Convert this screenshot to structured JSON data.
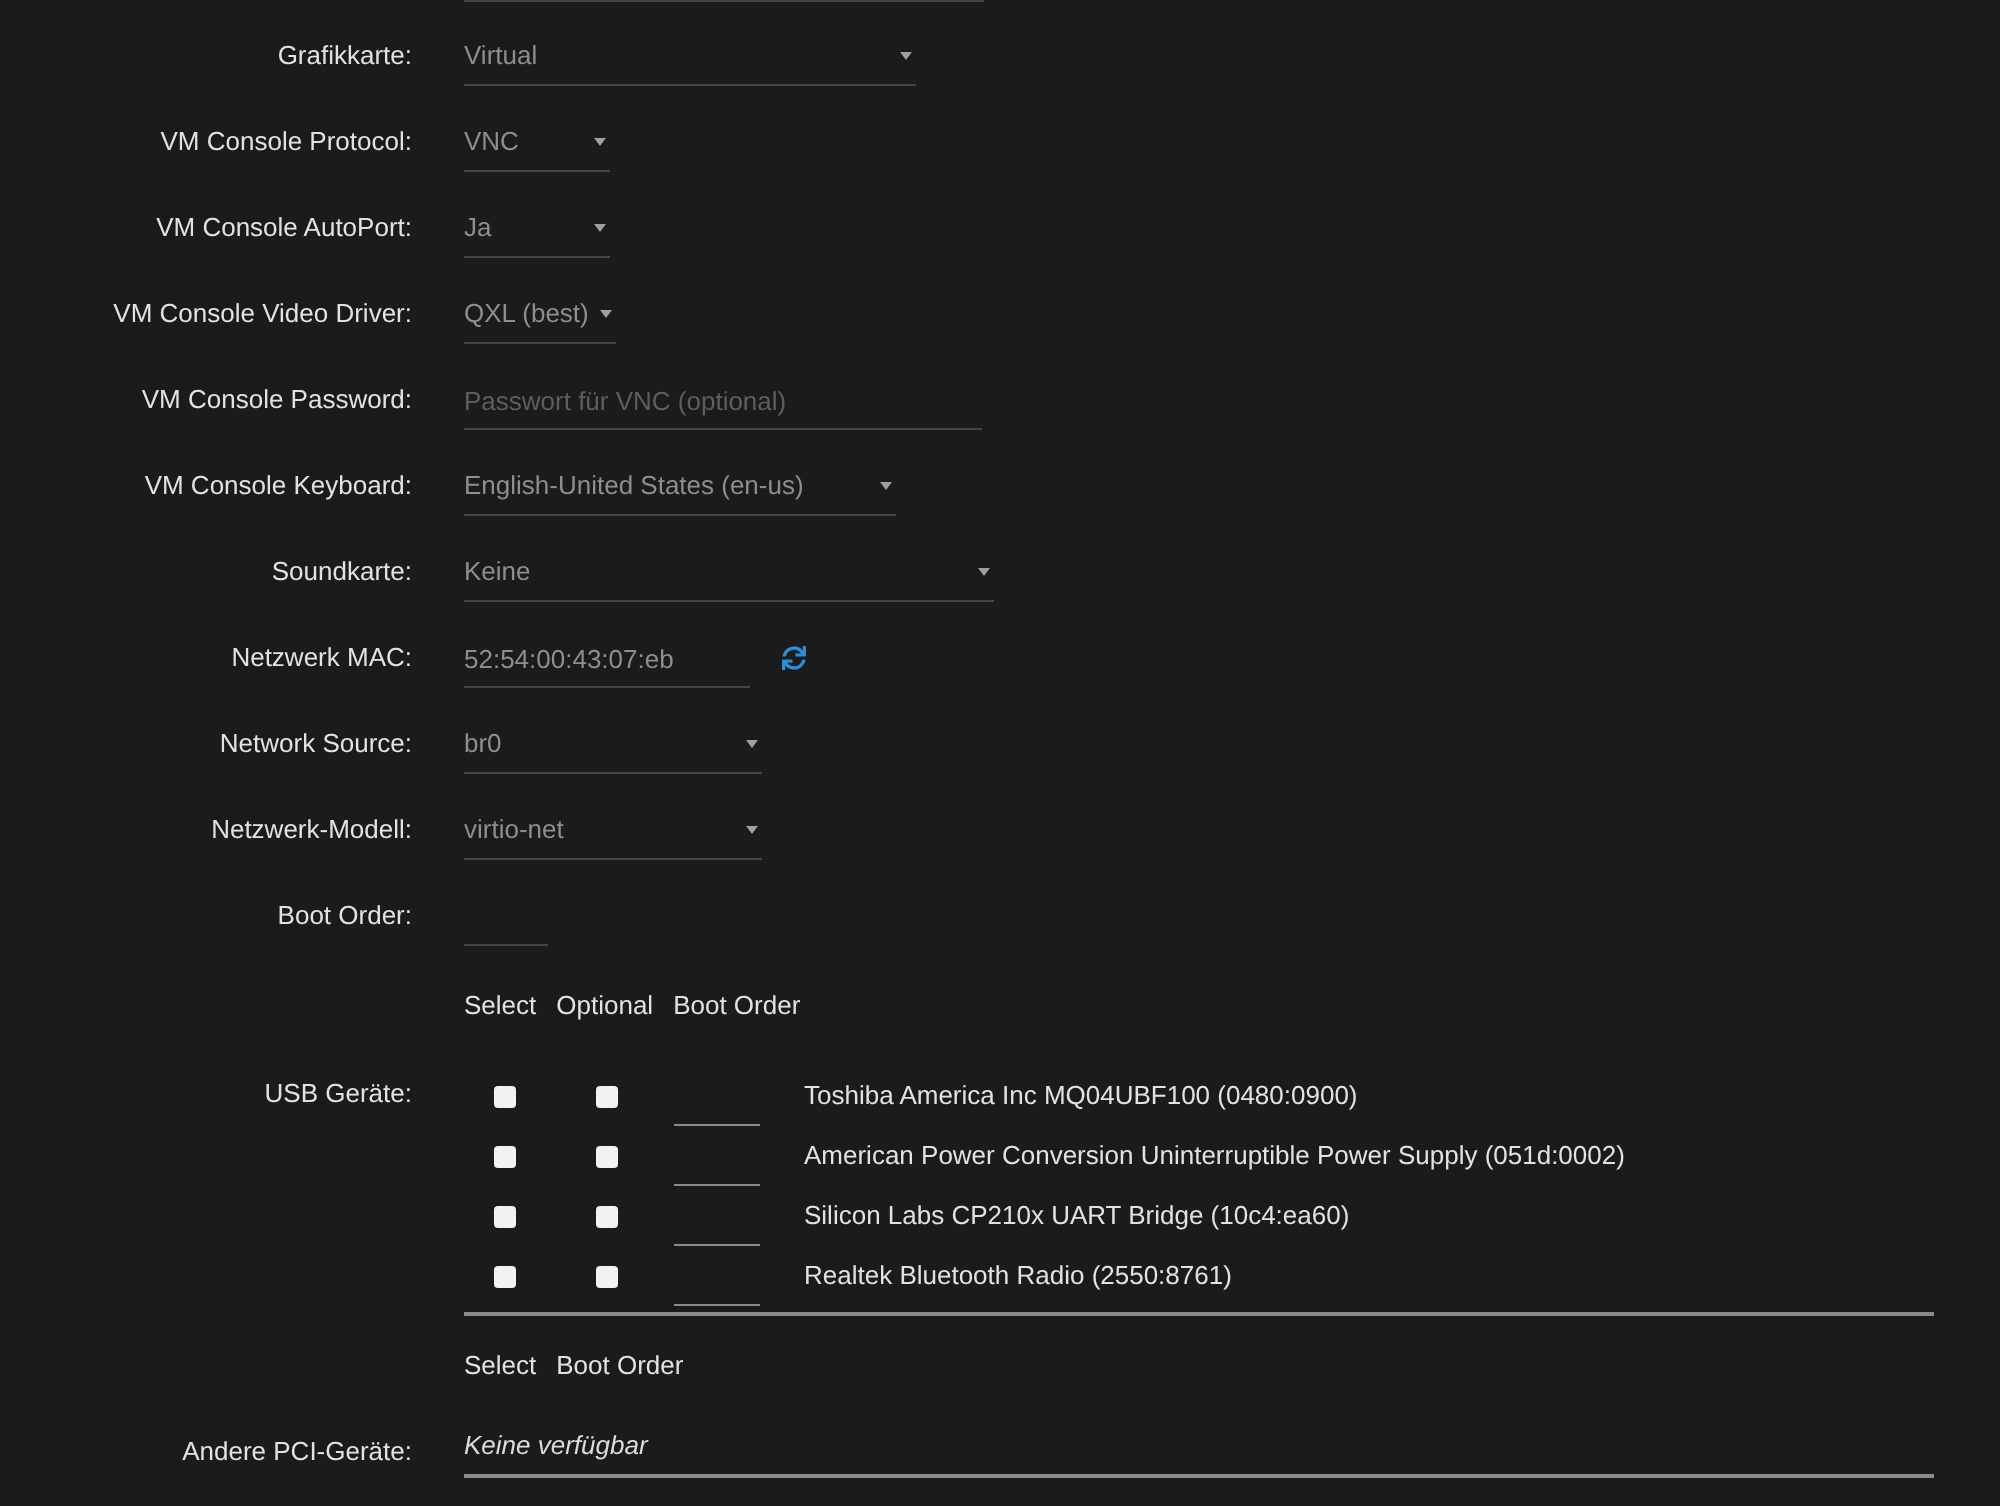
{
  "fields": [
    {
      "kind": "select",
      "label": "Grafikkarte:",
      "value": "Virtual"
    },
    {
      "kind": "select",
      "label": "VM Console Protocol:",
      "value": "VNC"
    },
    {
      "kind": "select",
      "label": "VM Console AutoPort:",
      "value": "Ja"
    },
    {
      "kind": "select",
      "label": "VM Console Video Driver:",
      "value": "QXL (best)"
    },
    {
      "kind": "input",
      "label": "VM Console Password:",
      "placeholder": "Passwort für VNC (optional)"
    },
    {
      "kind": "select",
      "label": "VM Console Keyboard:",
      "value": "English-United States (en-us)"
    },
    {
      "kind": "select",
      "label": "Soundkarte:",
      "value": "Keine"
    },
    {
      "kind": "mac",
      "label": "Netzwerk MAC:",
      "value": "52:54:00:43:07:eb"
    },
    {
      "kind": "select",
      "label": "Network Source:",
      "value": "br0"
    },
    {
      "kind": "select",
      "label": "Netzwerk-Modell:",
      "value": "virtio-net"
    },
    {
      "kind": "input",
      "label": "Boot Order:"
    }
  ],
  "usb": {
    "headers": [
      "Select",
      "Optional",
      "Boot Order"
    ],
    "label": "USB Geräte:",
    "devices": [
      {
        "select_checked": false,
        "optional_checked": false,
        "name": "Toshiba America Inc MQ04UBF100 (0480:0900)"
      },
      {
        "select_checked": false,
        "optional_checked": false,
        "name": "American Power Conversion Uninterruptible Power Supply (051d:0002)"
      },
      {
        "select_checked": false,
        "optional_checked": false,
        "name": "Silicon Labs CP210x UART Bridge (10c4:ea60)"
      },
      {
        "select_checked": false,
        "optional_checked": false,
        "name": "Realtek Bluetooth Radio (2550:8761)"
      }
    ]
  },
  "pci": {
    "headers": [
      "Select",
      "Boot Order"
    ],
    "label": "Andere PCI-Geräte:",
    "value": "Keine verfügbar"
  }
}
